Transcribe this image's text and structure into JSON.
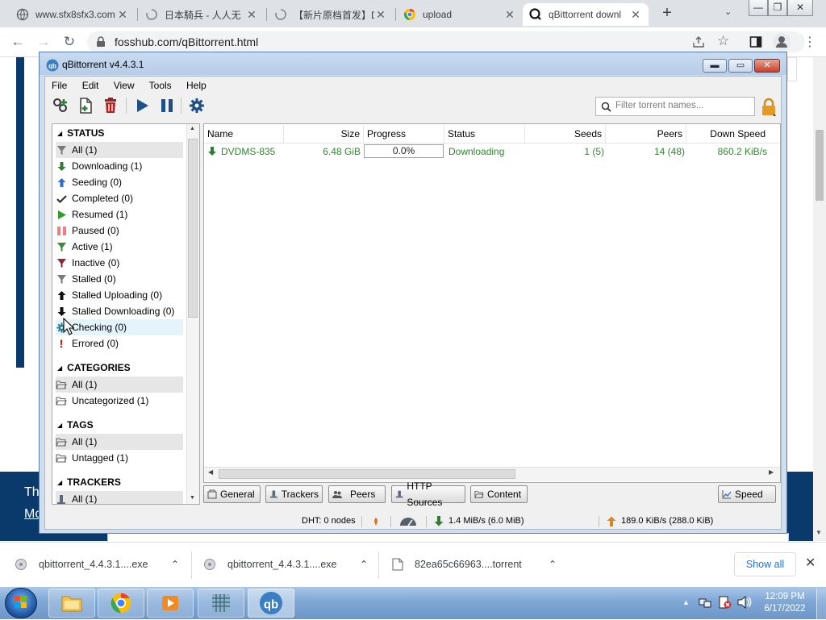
{
  "browser": {
    "tabs": [
      {
        "title": "www.sfx8sfx3.com",
        "icon": "globe-icon"
      },
      {
        "title": "日本騎兵 - 人人无",
        "icon": "loading-icon"
      },
      {
        "title": "【新片原档首发】D",
        "icon": "loading-icon"
      },
      {
        "title": "upload",
        "icon": "chrome-icon"
      },
      {
        "title": "qBittorrent downl",
        "icon": "qbittorrent-icon"
      }
    ],
    "new_tab": "+",
    "url": "fosshub.com/qBittorrent.html"
  },
  "page_behind": {
    "text_1": "Th",
    "text_2": "Mo"
  },
  "qbittorrent": {
    "title": "qBittorrent v4.4.3.1",
    "menu": [
      "File",
      "Edit",
      "View",
      "Tools",
      "Help"
    ],
    "search_placeholder": "Filter torrent names...",
    "sidebar": {
      "status_header": "STATUS",
      "status_items": [
        {
          "label": "All (1)",
          "icon": "filter-icon",
          "color": "#7a7a7a"
        },
        {
          "label": "Downloading (1)",
          "icon": "download-arrow-icon",
          "color": "#2e7d32"
        },
        {
          "label": "Seeding (0)",
          "icon": "upload-arrow-icon",
          "color": "#2b6ed8"
        },
        {
          "label": "Completed (0)",
          "icon": "checkmark-icon",
          "color": "#333333"
        },
        {
          "label": "Resumed (1)",
          "icon": "play-icon",
          "color": "#2e9d2e"
        },
        {
          "label": "Paused (0)",
          "icon": "pause-icon",
          "color": "#f08080"
        },
        {
          "label": "Active (1)",
          "icon": "active-filter-icon",
          "color": "#3a8a3a"
        },
        {
          "label": "Inactive (0)",
          "icon": "inactive-filter-icon",
          "color": "#8b2b2b"
        },
        {
          "label": "Stalled (0)",
          "icon": "stalled-filter-icon",
          "color": "#7a7a7a"
        },
        {
          "label": "Stalled Uploading (0)",
          "icon": "stalled-upload-icon",
          "color": "#111111"
        },
        {
          "label": "Stalled Downloading (0)",
          "icon": "stalled-download-icon",
          "color": "#111111"
        },
        {
          "label": "Checking (0)",
          "icon": "checking-gear-icon",
          "color": "#1c7a8a"
        },
        {
          "label": "Errored (0)",
          "icon": "error-icon",
          "color": "#d00000"
        }
      ],
      "categories_header": "CATEGORIES",
      "categories_items": [
        {
          "label": "All (1)"
        },
        {
          "label": "Uncategorized (1)"
        }
      ],
      "tags_header": "TAGS",
      "tags_items": [
        {
          "label": "All (1)"
        },
        {
          "label": "Untagged (1)"
        }
      ],
      "trackers_header": "TRACKERS",
      "trackers_items": [
        {
          "label": "All (1)"
        }
      ]
    },
    "columns": [
      "Name",
      "Size",
      "Progress",
      "Status",
      "Seeds",
      "Peers",
      "Down Speed"
    ],
    "torrent": {
      "name": "DVDMS-835",
      "size": "6.48 GiB",
      "progress_text": "0.0%",
      "progress": 0.0,
      "status": "Downloading",
      "seeds": "1 (5)",
      "peers": "14 (48)",
      "down_speed": "860.2 KiB/s"
    },
    "bottom_tabs": [
      "General",
      "Trackers",
      "Peers",
      "HTTP Sources",
      "Content"
    ],
    "speed_button": "Speed",
    "statusbar": {
      "dht": "DHT: 0 nodes",
      "down": "1.4 MiB/s (6.0 MiB)",
      "up": "189.0 KiB/s (288.0 KiB)"
    }
  },
  "downloads_bar": {
    "items": [
      "qbittorrent_4.4.3.1....exe",
      "qbittorrent_4.4.3.1....exe",
      "82ea65c66963....torrent"
    ],
    "show_all": "Show all"
  },
  "taskbar": {
    "time": "12:09 PM",
    "date": "6/17/2022"
  }
}
